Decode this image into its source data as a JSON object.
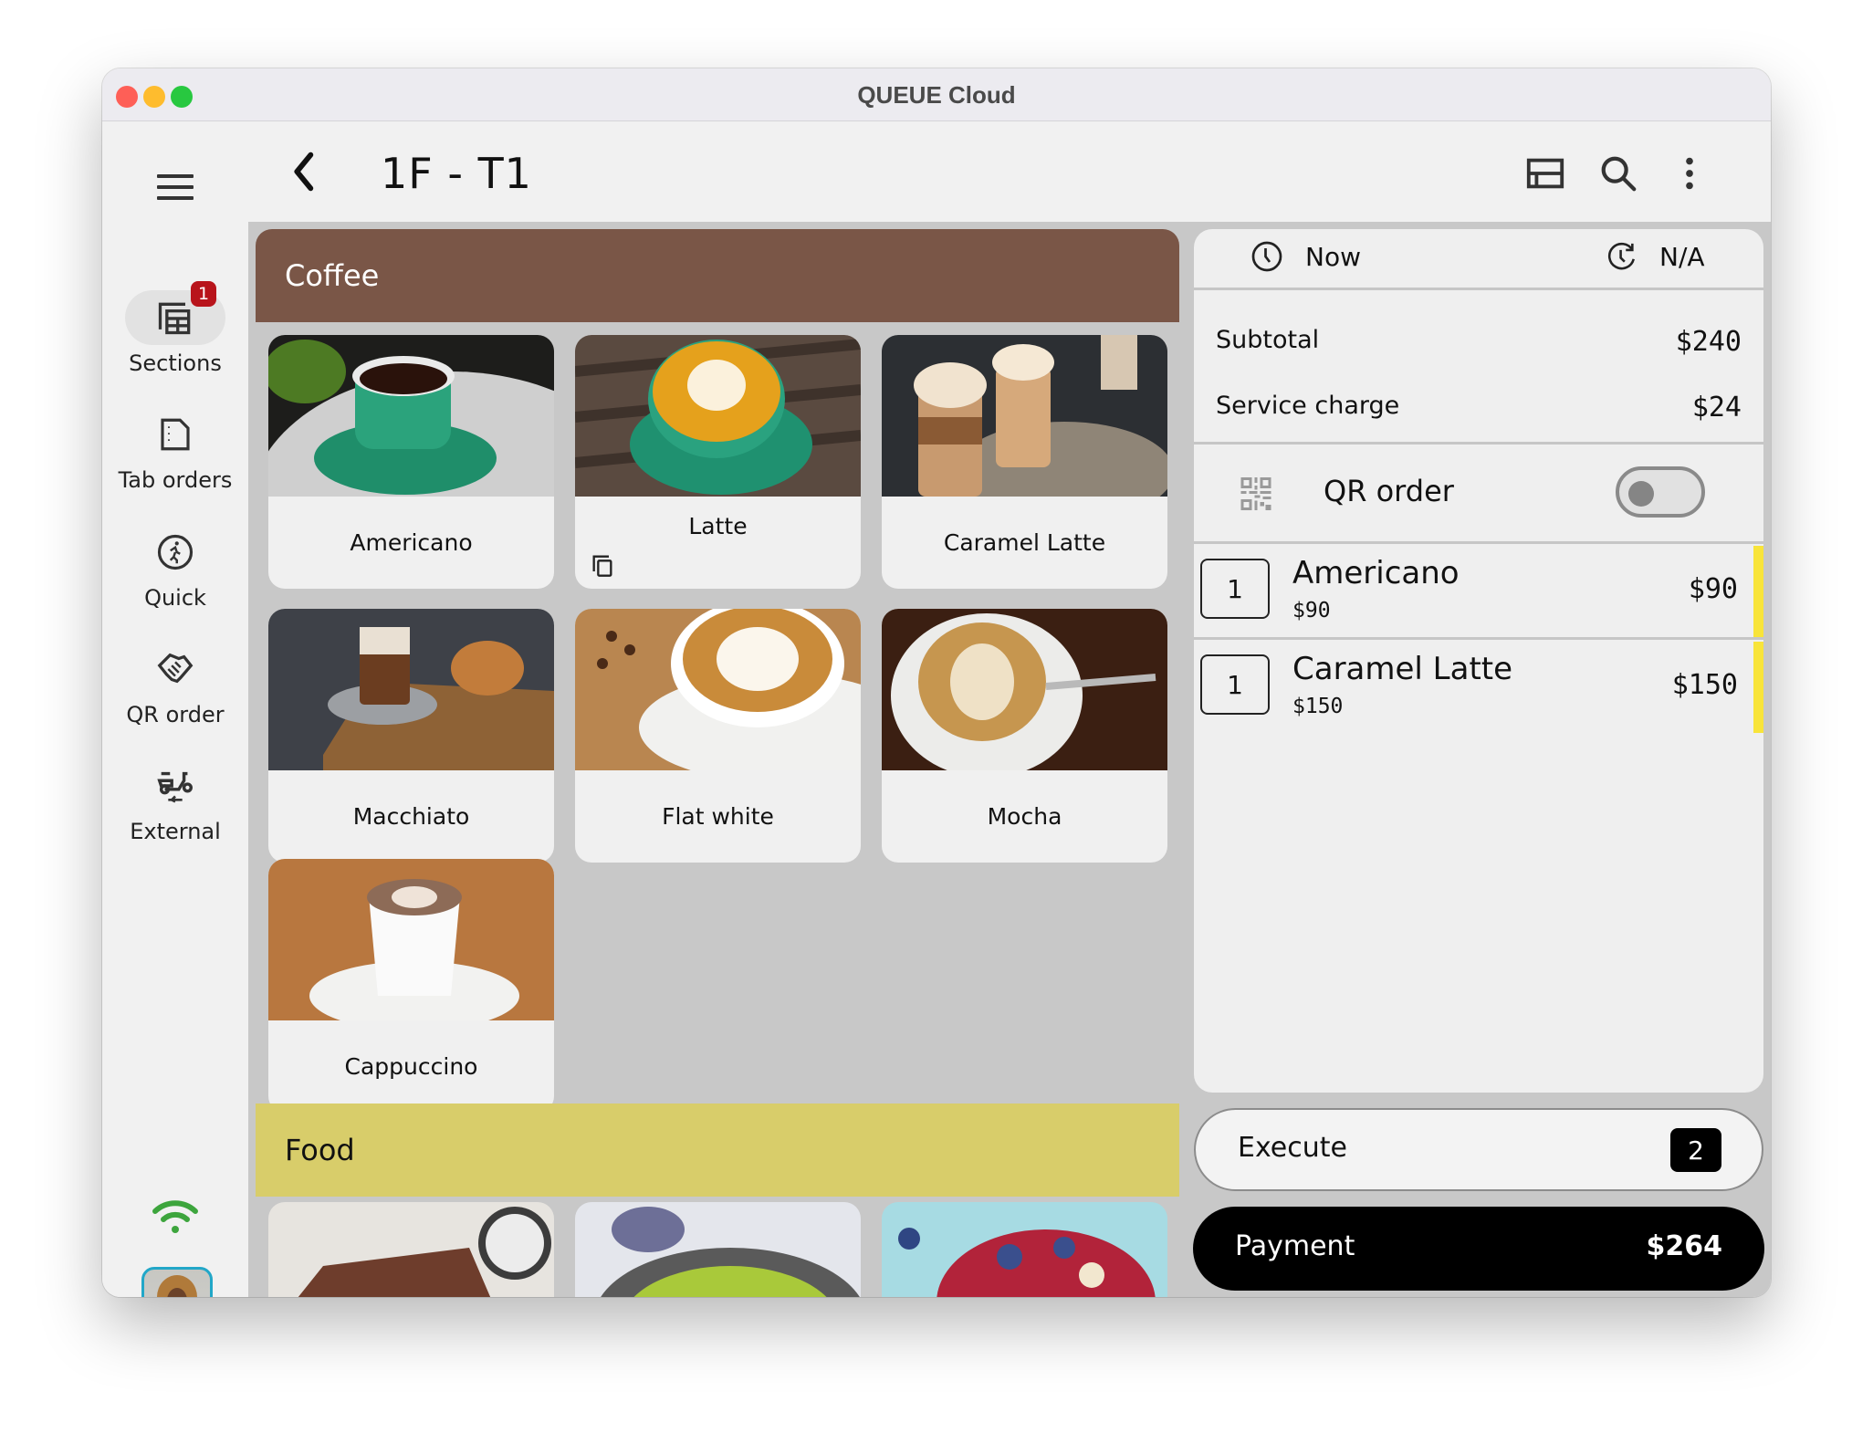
{
  "window": {
    "title": "QUEUE Cloud"
  },
  "header": {
    "title": "1F - T1",
    "icons": [
      "menu-icon",
      "back-icon",
      "layout-icon",
      "search-icon",
      "more-vert-icon"
    ]
  },
  "sidebar": {
    "items": [
      {
        "label": "Sections",
        "icon": "table-grid-icon",
        "badge": "1",
        "active": true
      },
      {
        "label": "Tab orders",
        "icon": "tab-document-icon"
      },
      {
        "label": "Quick",
        "icon": "running-person-icon"
      },
      {
        "label": "QR order",
        "icon": "handshake-icon"
      },
      {
        "label": "External",
        "icon": "delivery-scooter-icon"
      }
    ],
    "status_icon": "wifi-icon",
    "status_color": "#3da53d"
  },
  "menu": {
    "categories": [
      {
        "name": "Coffee",
        "color": "#7a5647",
        "items": [
          {
            "label": "Americano"
          },
          {
            "label": "Latte",
            "has_variants": true
          },
          {
            "label": "Caramel Latte"
          },
          {
            "label": "Macchiato"
          },
          {
            "label": "Flat white"
          },
          {
            "label": "Mocha"
          },
          {
            "label": "Cappuccino"
          }
        ]
      },
      {
        "name": "Food",
        "color": "#d8cd6a",
        "items": []
      }
    ]
  },
  "order": {
    "time_label": "Now",
    "pickup_label": "N/A",
    "subtotal_label": "Subtotal",
    "subtotal": "$240",
    "service_label": "Service charge",
    "service": "$24",
    "qr_label": "QR order",
    "qr_enabled": false,
    "items": [
      {
        "qty": "1",
        "name": "Americano",
        "unit_price": "$90",
        "total": "$90"
      },
      {
        "qty": "1",
        "name": "Caramel Latte",
        "unit_price": "$150",
        "total": "$150"
      }
    ],
    "execute_label": "Execute",
    "execute_count": "2",
    "payment_label": "Payment",
    "payment_total": "$264",
    "pending_color": "#f8e43a"
  }
}
